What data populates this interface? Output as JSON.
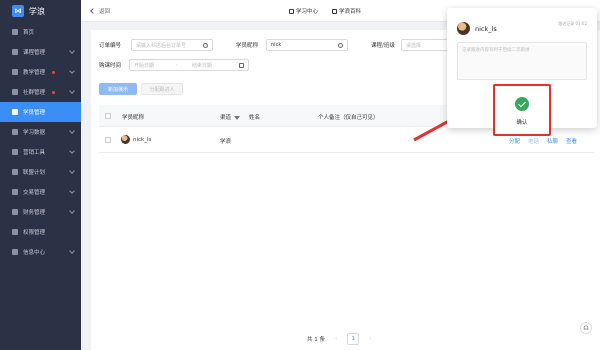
{
  "brand": {
    "name": "学浪"
  },
  "sidebar": {
    "items": [
      {
        "label": "首页",
        "dot": false,
        "chevron": false,
        "active": false
      },
      {
        "label": "课程管理",
        "dot": false,
        "chevron": true,
        "active": false
      },
      {
        "label": "教学管理",
        "dot": true,
        "chevron": true,
        "active": false
      },
      {
        "label": "社群管理",
        "dot": true,
        "chevron": true,
        "active": false
      },
      {
        "label": "学员管理",
        "dot": false,
        "chevron": false,
        "active": true
      },
      {
        "label": "学习数据",
        "dot": false,
        "chevron": true,
        "active": false
      },
      {
        "label": "营销工具",
        "dot": false,
        "chevron": true,
        "active": false
      },
      {
        "label": "联盟计划",
        "dot": false,
        "chevron": true,
        "active": false
      },
      {
        "label": "交易管理",
        "dot": false,
        "chevron": true,
        "active": false
      },
      {
        "label": "财务管理",
        "dot": false,
        "chevron": true,
        "active": false
      },
      {
        "label": "权限管理",
        "dot": false,
        "chevron": false,
        "active": false
      },
      {
        "label": "信息中心",
        "dot": false,
        "chevron": true,
        "active": false
      }
    ]
  },
  "topbar": {
    "back_label": "返回",
    "link1": "学习中心",
    "link2": "学浪百科"
  },
  "filters": {
    "order_label": "订单编号",
    "order_placeholder": "请输入科店后台订单号",
    "nick_label": "学员昵称",
    "nick_value": "nick",
    "course_label": "课程/班级",
    "course_placeholder": "请选择",
    "time_label": "购课时间",
    "start_placeholder": "开始日期",
    "sep": "-",
    "end_placeholder": "结束日期"
  },
  "buttons": {
    "add_follow": "新加演示",
    "assign": "分配跟进人"
  },
  "table": {
    "headers": {
      "nick": "学员昵称",
      "channel": "渠道",
      "name": "姓名",
      "remark": "个人备注（仅自己可见）"
    },
    "rows": [
      {
        "nick": "nick_ls",
        "channel": "学浪"
      }
    ],
    "actions": [
      "分配",
      "电话",
      "私聊",
      "查看"
    ]
  },
  "pager": {
    "total": "共 1 条",
    "page": "1",
    "prev": "‹",
    "next": "›"
  },
  "popup": {
    "user": "nick_ls",
    "meta": "跟进记录 01:02",
    "placeholder": "记录跟进内容有利于后续二次跟进",
    "confirm": "确认"
  },
  "colors": {
    "accent": "#3a8ef6",
    "sidebar": "#2b3245",
    "highlight": "#e0322a",
    "success": "#3aa55c"
  }
}
